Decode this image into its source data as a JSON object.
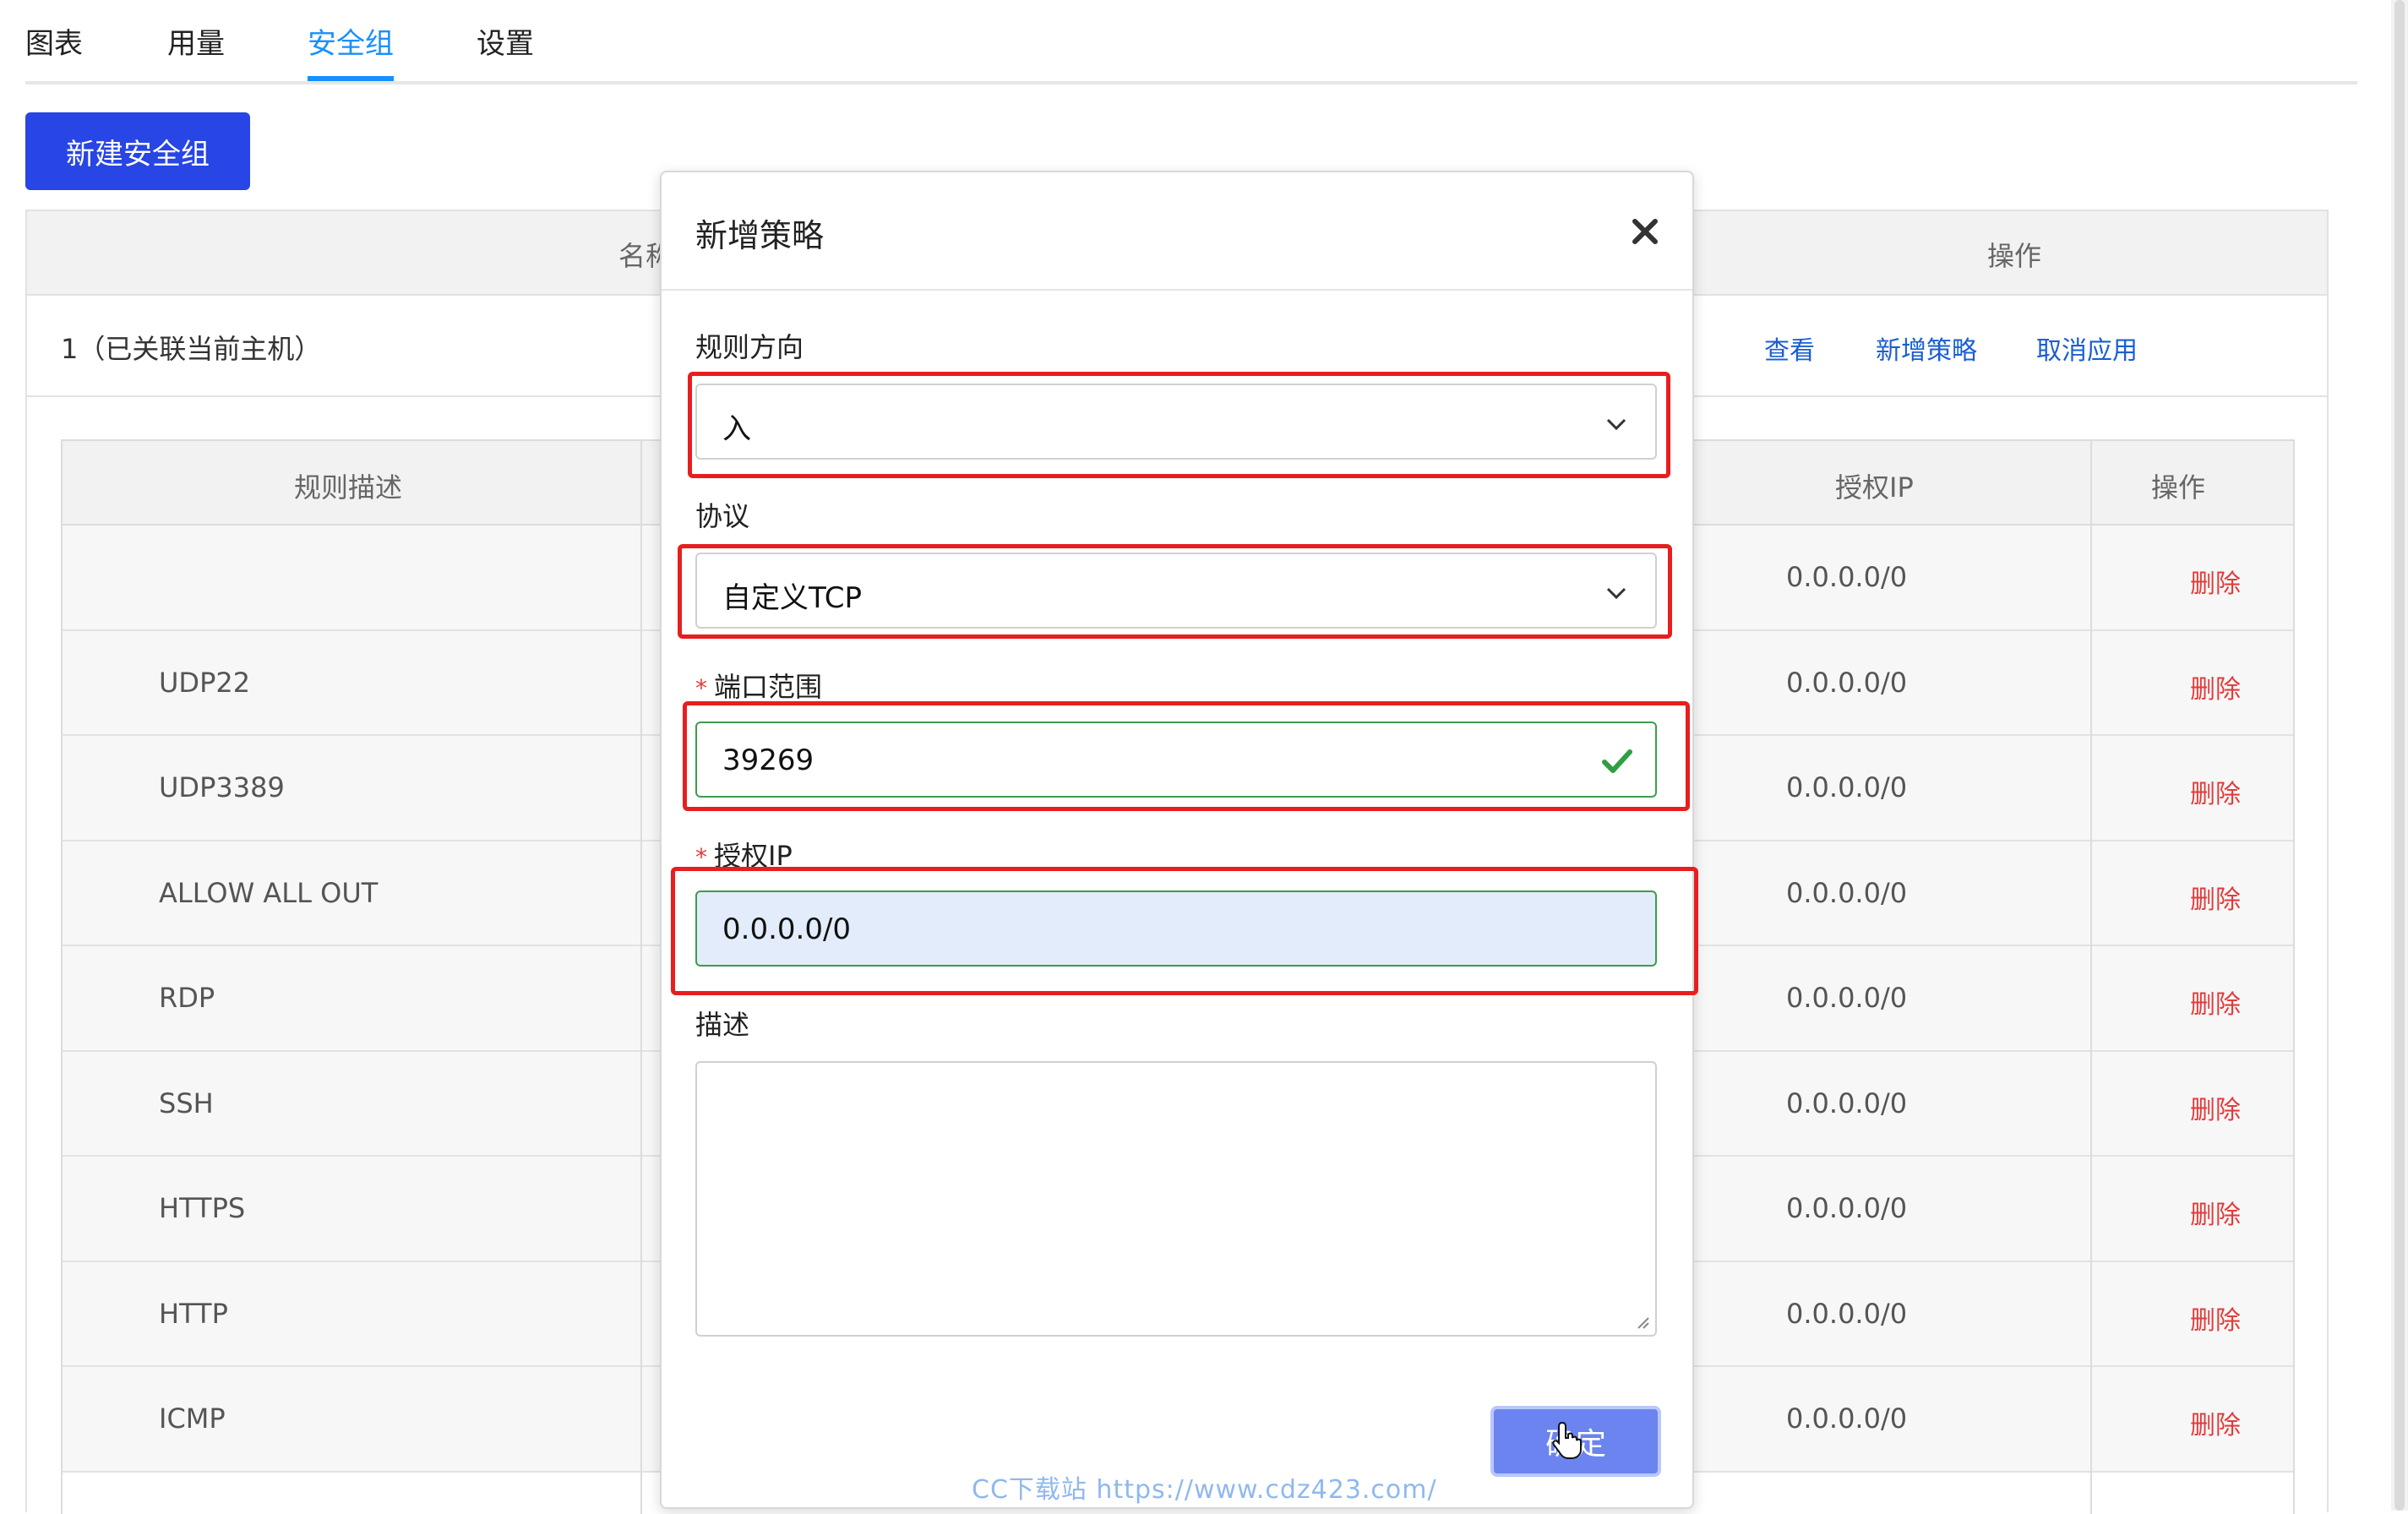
{
  "tabs": [
    {
      "label": "图表"
    },
    {
      "label": "用量"
    },
    {
      "label": "安全组"
    },
    {
      "label": "设置"
    }
  ],
  "active_tab": "安全组",
  "new_group_button": "新建安全组",
  "group_table": {
    "headers": {
      "name": "名称",
      "actions": "操作"
    },
    "row": {
      "name": "1（已关联当前主机）",
      "actions": {
        "view": "查看",
        "add_policy": "新增策略",
        "cancel_apply": "取消应用"
      }
    }
  },
  "rules_table": {
    "headers": {
      "description": "规则描述",
      "ip": "授权IP",
      "actions": "操作"
    },
    "rows": [
      {
        "description": "",
        "ip": "0.0.0.0/0",
        "action": "删除"
      },
      {
        "description": "UDP22",
        "ip": "0.0.0.0/0",
        "action": "删除"
      },
      {
        "description": "UDP3389",
        "ip": "0.0.0.0/0",
        "action": "删除"
      },
      {
        "description": "ALLOW ALL OUT",
        "ip": "0.0.0.0/0",
        "action": "删除"
      },
      {
        "description": "RDP",
        "ip": "0.0.0.0/0",
        "action": "删除"
      },
      {
        "description": "SSH",
        "ip": "0.0.0.0/0",
        "action": "删除"
      },
      {
        "description": "HTTPS",
        "ip": "0.0.0.0/0",
        "action": "删除"
      },
      {
        "description": "HTTP",
        "ip": "0.0.0.0/0",
        "action": "删除"
      },
      {
        "description": "ICMP",
        "ip": "0.0.0.0/0",
        "action": "删除"
      }
    ]
  },
  "modal": {
    "title": "新增策略",
    "direction": {
      "label": "规则方向",
      "value": "入"
    },
    "protocol": {
      "label": "协议",
      "value": "自定义TCP"
    },
    "port": {
      "required_mark": "*",
      "label": "端口范围",
      "value": "39269"
    },
    "ip": {
      "required_mark": "*",
      "label": "授权IP",
      "value": "0.0.0.0/0"
    },
    "description": {
      "label": "描述",
      "value": ""
    },
    "confirm_button": "确定"
  },
  "watermark": "CC下载站 https://www.cdz423.com/",
  "colors": {
    "primary": "#2845e6",
    "tab_active": "#1890ff",
    "link": "#1a5fd1",
    "danger": "#e23c3c",
    "success": "#3c9d4c",
    "highlight": "#e81e1e"
  }
}
